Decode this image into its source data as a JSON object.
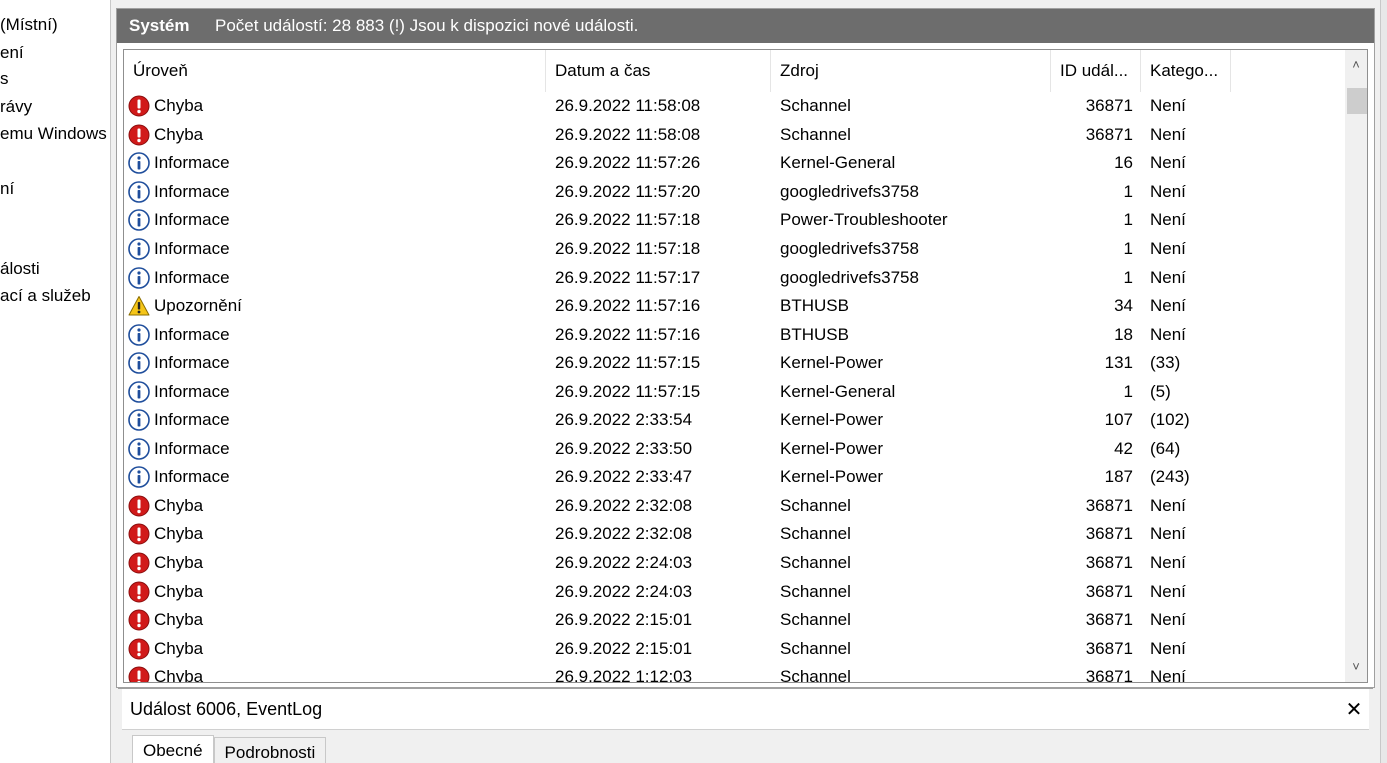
{
  "left_tree": {
    "items": [
      "(Místní)",
      "ení",
      "s",
      "rávy",
      "emu Windows",
      "",
      "ní",
      "",
      "",
      "álosti",
      "ací a služeb"
    ]
  },
  "titlebar": {
    "log_name": "Systém",
    "log_info": "Počet událostí: 28 883 (!) Jsou k dispozici nové události."
  },
  "columns": {
    "level": "Úroveň",
    "date": "Datum a čas",
    "source": "Zdroj",
    "id": "ID udál...",
    "category": "Katego..."
  },
  "rows": [
    {
      "level": "Chyba",
      "icon": "error",
      "date": "26.9.2022 11:58:08",
      "source": "Schannel",
      "id": "36871",
      "category": "Není"
    },
    {
      "level": "Chyba",
      "icon": "error",
      "date": "26.9.2022 11:58:08",
      "source": "Schannel",
      "id": "36871",
      "category": "Není"
    },
    {
      "level": "Informace",
      "icon": "info",
      "date": "26.9.2022 11:57:26",
      "source": "Kernel-General",
      "id": "16",
      "category": "Není"
    },
    {
      "level": "Informace",
      "icon": "info",
      "date": "26.9.2022 11:57:20",
      "source": "googledrivefs3758",
      "id": "1",
      "category": "Není"
    },
    {
      "level": "Informace",
      "icon": "info",
      "date": "26.9.2022 11:57:18",
      "source": "Power-Troubleshooter",
      "id": "1",
      "category": "Není"
    },
    {
      "level": "Informace",
      "icon": "info",
      "date": "26.9.2022 11:57:18",
      "source": "googledrivefs3758",
      "id": "1",
      "category": "Není"
    },
    {
      "level": "Informace",
      "icon": "info",
      "date": "26.9.2022 11:57:17",
      "source": "googledrivefs3758",
      "id": "1",
      "category": "Není"
    },
    {
      "level": "Upozornění",
      "icon": "warning",
      "date": "26.9.2022 11:57:16",
      "source": "BTHUSB",
      "id": "34",
      "category": "Není"
    },
    {
      "level": "Informace",
      "icon": "info",
      "date": "26.9.2022 11:57:16",
      "source": "BTHUSB",
      "id": "18",
      "category": "Není"
    },
    {
      "level": "Informace",
      "icon": "info",
      "date": "26.9.2022 11:57:15",
      "source": "Kernel-Power",
      "id": "131",
      "category": "(33)"
    },
    {
      "level": "Informace",
      "icon": "info",
      "date": "26.9.2022 11:57:15",
      "source": "Kernel-General",
      "id": "1",
      "category": "(5)"
    },
    {
      "level": "Informace",
      "icon": "info",
      "date": "26.9.2022 2:33:54",
      "source": "Kernel-Power",
      "id": "107",
      "category": "(102)"
    },
    {
      "level": "Informace",
      "icon": "info",
      "date": "26.9.2022 2:33:50",
      "source": "Kernel-Power",
      "id": "42",
      "category": "(64)"
    },
    {
      "level": "Informace",
      "icon": "info",
      "date": "26.9.2022 2:33:47",
      "source": "Kernel-Power",
      "id": "187",
      "category": "(243)"
    },
    {
      "level": "Chyba",
      "icon": "error",
      "date": "26.9.2022 2:32:08",
      "source": "Schannel",
      "id": "36871",
      "category": "Není"
    },
    {
      "level": "Chyba",
      "icon": "error",
      "date": "26.9.2022 2:32:08",
      "source": "Schannel",
      "id": "36871",
      "category": "Není"
    },
    {
      "level": "Chyba",
      "icon": "error",
      "date": "26.9.2022 2:24:03",
      "source": "Schannel",
      "id": "36871",
      "category": "Není"
    },
    {
      "level": "Chyba",
      "icon": "error",
      "date": "26.9.2022 2:24:03",
      "source": "Schannel",
      "id": "36871",
      "category": "Není"
    },
    {
      "level": "Chyba",
      "icon": "error",
      "date": "26.9.2022 2:15:01",
      "source": "Schannel",
      "id": "36871",
      "category": "Není"
    },
    {
      "level": "Chyba",
      "icon": "error",
      "date": "26.9.2022 2:15:01",
      "source": "Schannel",
      "id": "36871",
      "category": "Není"
    },
    {
      "level": "Chyba",
      "icon": "error",
      "date": "26.9.2022 1:12:03",
      "source": "Schannel",
      "id": "36871",
      "category": "Není"
    }
  ],
  "detail": {
    "title": "Událost 6006, EventLog",
    "close_glyph": "✕",
    "tabs": [
      "Obecné",
      "Podrobnosti"
    ]
  },
  "scrollbar": {
    "up": "˄",
    "down": "˅"
  },
  "colors": {
    "titlebar_bg": "#6d6d6d",
    "error_red": "#d11a1a",
    "info_blue": "#1f4e9c",
    "warning_yellow": "#f5c518"
  }
}
